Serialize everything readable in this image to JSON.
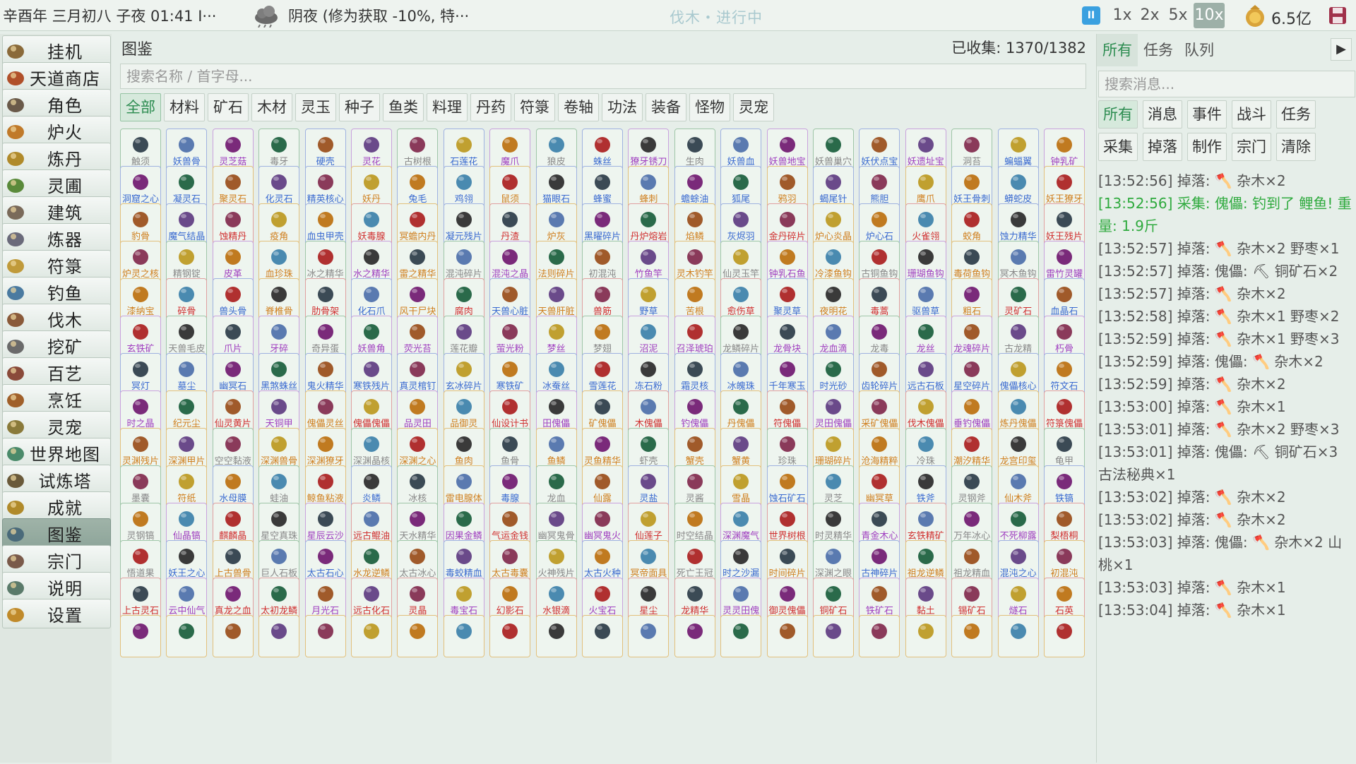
{
  "topbar": {
    "date": "辛酉年 三月初八 子夜 01:41 I···",
    "weather": "阴夜 (修为获取 -10%, 特···",
    "status": "伐木・进行中",
    "pause": "II",
    "speeds": [
      "1x",
      "2x",
      "5x",
      "10x"
    ],
    "active_speed": "10x",
    "coins": "6.5亿"
  },
  "sidebar": {
    "items": [
      "挂机",
      "天道商店",
      "角色",
      "炉火",
      "炼丹",
      "灵圃",
      "建筑",
      "炼器",
      "符箓",
      "钓鱼",
      "伐木",
      "挖矿",
      "百艺",
      "烹饪",
      "灵宠",
      "世界地图",
      "试炼塔",
      "成就",
      "图鉴",
      "宗门",
      "说明",
      "设置"
    ],
    "active": "图鉴"
  },
  "main": {
    "title": "图鉴",
    "count": "已收集: 1370/1382",
    "search_placeholder": "搜索名称 / 首字母...",
    "categories": [
      "全部",
      "材料",
      "矿石",
      "木材",
      "灵玉",
      "种子",
      "鱼类",
      "料理",
      "丹药",
      "符箓",
      "卷轴",
      "功法",
      "装备",
      "怪物",
      "灵宠"
    ],
    "active_category": "全部",
    "items": [
      "触须",
      "妖兽骨",
      "灵芝菇",
      "毒牙",
      "硬壳",
      "灵花",
      "古树根",
      "石莲花",
      "魔爪",
      "狼皮",
      "蛛丝",
      "獠牙锈刀",
      "生肉",
      "妖兽血",
      "妖兽地宝",
      "妖兽巢穴",
      "妖伏点宝",
      "妖遗址宝",
      "洞苔",
      "蝙蝠翼",
      "钟乳矿",
      "洞窟之心",
      "凝灵石",
      "聚灵石",
      "化灵石",
      "精英核心",
      "妖丹",
      "兔毛",
      "鸡翎",
      "鼠须",
      "猫眼石",
      "蜂蜜",
      "蜂刺",
      "蟾蜍油",
      "狐尾",
      "鸦羽",
      "蝎尾针",
      "熊胆",
      "鹰爪",
      "妖王骨刺",
      "蟒蛇皮",
      "妖王獠牙",
      "豹骨",
      "魔气结晶",
      "蚀精丹",
      "疫角",
      "血虫甲壳",
      "妖毒腺",
      "冥蟾内丹",
      "凝元残片",
      "丹渣",
      "炉灰",
      "黑曜碎片",
      "丹炉熔岩",
      "焰鳞",
      "灰烬羽",
      "金丹碎片",
      "炉心炎晶",
      "炉心石",
      "火雀翎",
      "蛟角",
      "蚀力精华",
      "妖王残片",
      "炉灵之核",
      "精钢锭",
      "皮革",
      "血珍珠",
      "冰之精华",
      "水之精华",
      "雷之精华",
      "混沌碎片",
      "混沌之晶",
      "法则碎片",
      "初混沌",
      "竹鱼竿",
      "灵木钓竿",
      "仙灵玉竿",
      "钟乳石鱼",
      "冷漆鱼钩",
      "古铜鱼钩",
      "珊瑚鱼钩",
      "毒荷鱼钩",
      "冥木鱼钩",
      "雷竹灵罐",
      "漆纳宝",
      "碎骨",
      "兽头骨",
      "脊椎骨",
      "肋骨架",
      "化石爪",
      "风干尸块",
      "腐肉",
      "天兽心脏",
      "天兽肝脏",
      "兽筋",
      "野草",
      "苦根",
      "愈伤草",
      "聚灵草",
      "夜明花",
      "毒蒿",
      "驱兽草",
      "粗石",
      "灵矿石",
      "血晶石",
      "玄铁矿",
      "天兽毛皮",
      "爪片",
      "牙碎",
      "奇异蛋",
      "妖兽角",
      "荧光苔",
      "莲花瓣",
      "萤光粉",
      "梦丝",
      "梦翅",
      "沼泥",
      "召泽琥珀",
      "龙鳞碎片",
      "龙骨块",
      "龙血滴",
      "龙毒",
      "龙丝",
      "龙魂碎片",
      "古龙精",
      "朽骨",
      "冥灯",
      "墓尘",
      "幽冥石",
      "黑煞蛛丝",
      "鬼火精华",
      "寒铁残片",
      "真灵棺钉",
      "玄冰碎片",
      "寒铁矿",
      "冰蚕丝",
      "雪莲花",
      "冻石粉",
      "霜灵核",
      "冰魄珠",
      "千年寒玉",
      "时光砂",
      "齿轮碎片",
      "远古石板",
      "星空碎片",
      "傀儡核心",
      "符文石",
      "时之晶",
      "纪元尘",
      "仙灵黄片",
      "天铜甲",
      "傀儡灵丝",
      "傀儡傀儡",
      "品灵田",
      "品御灵",
      "仙设计书",
      "田傀儡",
      "矿傀儡",
      "木傀儡",
      "钓傀儡",
      "丹傀儡",
      "符傀儡",
      "灵田傀儡",
      "采矿傀儡",
      "伐木傀儡",
      "垂钓傀儡",
      "炼丹傀儡",
      "符箓傀儡",
      "灵渊残片",
      "深渊甲片",
      "空空黏液",
      "深渊兽骨",
      "深渊獠牙",
      "深渊晶核",
      "深渊之心",
      "鱼肉",
      "鱼骨",
      "鱼鳞",
      "灵鱼精华",
      "虾壳",
      "蟹壳",
      "蟹黄",
      "珍珠",
      "珊瑚碎片",
      "沧海精粹",
      "冷珠",
      "潮汐精华",
      "龙宫印玺",
      "龟甲",
      "墨囊",
      "符纸",
      "水母膜",
      "蛙油",
      "鲸鱼粘液",
      "炎鳞",
      "冰核",
      "雷电腺体",
      "毒腺",
      "龙血",
      "仙露",
      "灵盐",
      "灵酱",
      "雪晶",
      "蚀石矿石",
      "灵芝",
      "幽冥草",
      "铁斧",
      "灵钢斧",
      "仙木斧",
      "铁镐",
      "灵钢镐",
      "仙晶镐",
      "麒麟晶",
      "星空真珠",
      "星辰云沙",
      "远古鲲油",
      "天水精华",
      "因果金鳞",
      "气运金钱",
      "幽冥鬼骨",
      "幽冥鬼火",
      "仙莲子",
      "时空结晶",
      "深渊魔气",
      "世界树根",
      "时灵精华",
      "青金木心",
      "玄铁精矿",
      "万年冰心",
      "不死柳露",
      "梨梧桐",
      "悟道果",
      "妖王之心",
      "上古兽骨",
      "巨人石板",
      "太古石心",
      "水龙逆鳞",
      "太古冰心",
      "毒蛟精血",
      "太古毒囊",
      "火神残片",
      "太古火种",
      "冥帝面具",
      "死亡王冠",
      "时之沙漏",
      "时间碎片",
      "深渊之眼",
      "古神碎片",
      "祖龙逆鳞",
      "祖龙精血",
      "混沌之心",
      "初混沌",
      "上古灵石",
      "云中仙气",
      "真龙之血",
      "太初龙鳞",
      "月光石",
      "远古化石",
      "灵晶",
      "毒宝石",
      "幻影石",
      "水银滴",
      "火宝石",
      "星尘",
      "龙精华",
      "灵灵田傀",
      "御灵傀儡",
      "铜矿石",
      "铁矿石",
      "黏土",
      "锡矿石",
      "燧石",
      "石英",
      "",
      "",
      "",
      "",
      "",
      "",
      "",
      "",
      "",
      "",
      "",
      "",
      "",
      "",
      "",
      "",
      "",
      "",
      "",
      "",
      ""
    ]
  },
  "log": {
    "tabs": [
      "所有",
      "任务",
      "队列"
    ],
    "active_tab": "所有",
    "arrow": "▶",
    "search_placeholder": "搜索消息...",
    "filters": [
      "所有",
      "消息",
      "事件",
      "战斗",
      "任务",
      "采集",
      "掉落",
      "制作",
      "宗门",
      "清除"
    ],
    "active_filter": "所有",
    "lines": [
      {
        "text": "[13:52:56] 掉落: 🪓 杂木×2",
        "green": false
      },
      {
        "text": "[13:52:56] 采集: 傀儡: 钓到了 鲤鱼! 重量: 1.9斤",
        "green": true
      },
      {
        "text": "[13:52:57] 掉落: 🪓 杂木×2 野枣×1",
        "green": false
      },
      {
        "text": "[13:52:57] 掉落: 傀儡: ⛏ 铜矿石×2",
        "green": false
      },
      {
        "text": "[13:52:57] 掉落: 🪓 杂木×2",
        "green": false
      },
      {
        "text": "[13:52:58] 掉落: 🪓 杂木×1 野枣×2",
        "green": false
      },
      {
        "text": "[13:52:59] 掉落: 🪓 杂木×1 野枣×3",
        "green": false
      },
      {
        "text": "[13:52:59] 掉落: 傀儡: 🪓 杂木×2",
        "green": false
      },
      {
        "text": "[13:52:59] 掉落: 🪓 杂木×2",
        "green": false
      },
      {
        "text": "[13:53:00] 掉落: 🪓 杂木×1",
        "green": false
      },
      {
        "text": "[13:53:01] 掉落: 🪓 杂木×2 野枣×3",
        "green": false
      },
      {
        "text": "[13:53:01] 掉落: 傀儡: ⛏ 铜矿石×3 古法秘典×1",
        "green": false
      },
      {
        "text": "[13:53:02] 掉落: 🪓 杂木×2",
        "green": false
      },
      {
        "text": "[13:53:02] 掉落: 🪓 杂木×2",
        "green": false
      },
      {
        "text": "[13:53:03] 掉落: 傀儡: 🪓 杂木×2 山桃×1",
        "green": false
      },
      {
        "text": "[13:53:03] 掉落: 🪓 杂木×1",
        "green": false
      },
      {
        "text": "[13:53:04] 掉落: 🪓 杂木×1",
        "green": false
      }
    ]
  },
  "colors": {
    "accent_green": "#2c8c50",
    "log_green": "#2faa3e",
    "pause_blue": "#3aa0e0",
    "cell_border_green": "#9fc6a8",
    "cell_border_blue": "#9fb2e0",
    "cell_border_purple": "#c9a2dd",
    "cell_border_orange": "#e2c07c",
    "cell_border_red": "#e0a0a0"
  }
}
